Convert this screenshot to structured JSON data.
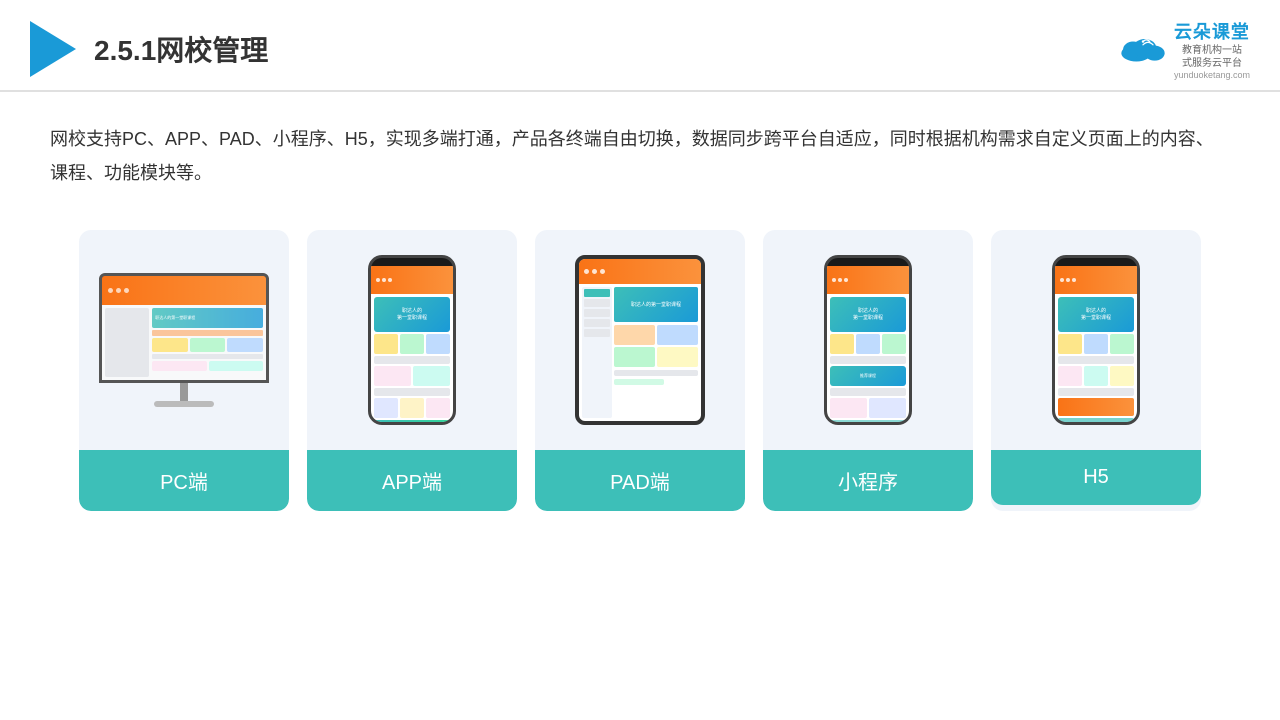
{
  "header": {
    "title": "2.5.1网校管理",
    "brand_name": "云朵课堂",
    "brand_url": "yunduoketang.com",
    "brand_tagline": "教育机构一站\n式服务云平台"
  },
  "description": {
    "text": "网校支持PC、APP、PAD、小程序、H5，实现多端打通，产品各终端自由切换，数据同步跨平台自适应，同时根据机构需求自定义页面上的内容、课程、功能模块等。"
  },
  "cards": [
    {
      "label": "PC端"
    },
    {
      "label": "APP端"
    },
    {
      "label": "PAD端"
    },
    {
      "label": "小程序"
    },
    {
      "label": "H5"
    }
  ],
  "colors": {
    "accent": "#3dbfb8",
    "blue": "#1a9ad7",
    "orange": "#f97316"
  }
}
